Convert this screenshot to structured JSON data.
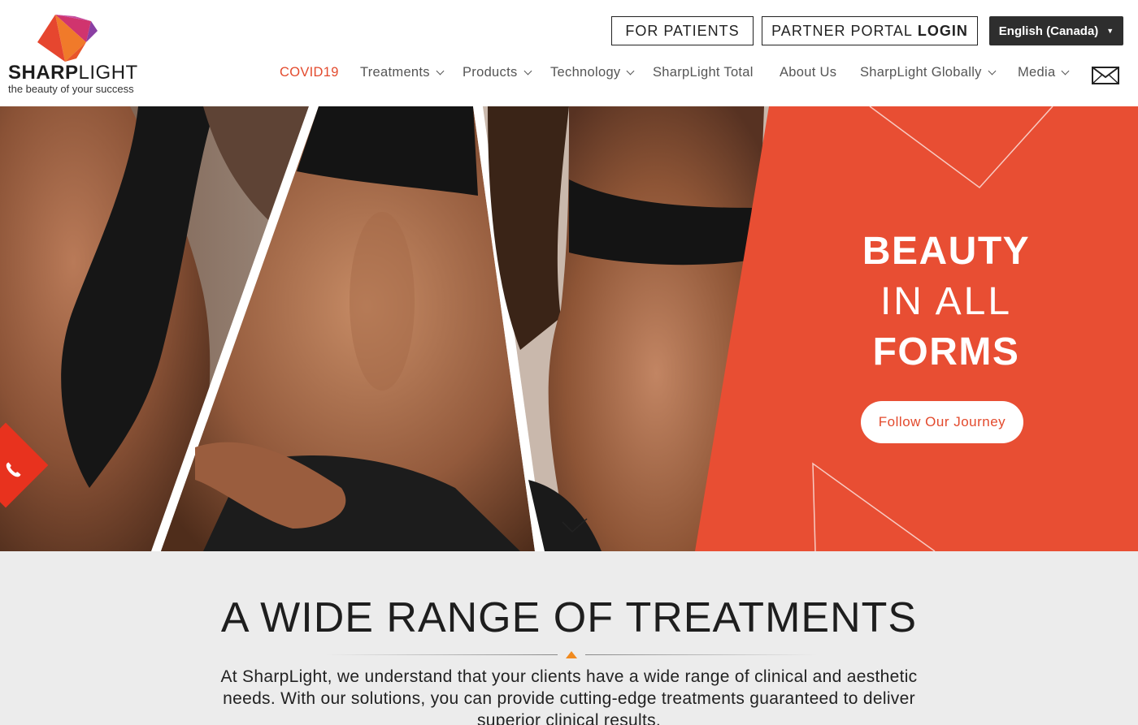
{
  "brand": {
    "name_bold": "SHARP",
    "name_light": "LIGHT",
    "tagline": "the beauty of your success",
    "colors": {
      "accent": "#e34a2d",
      "logo_pink": "#d0346e",
      "logo_orange": "#f07a2a",
      "logo_purple": "#7b3fa0"
    }
  },
  "header": {
    "patients_label": "FOR PATIENTS",
    "portal_label_light": "PARTNER PORTAL",
    "portal_label_bold": "LOGIN",
    "language_selected": "English (Canada)",
    "language_caret": "▼"
  },
  "nav": {
    "items": [
      {
        "label": "COVID19",
        "dropdown": false,
        "active": true
      },
      {
        "label": "Treatments",
        "dropdown": true
      },
      {
        "label": "Products",
        "dropdown": true
      },
      {
        "label": "Technology",
        "dropdown": true
      },
      {
        "label": "SharpLight Total",
        "dropdown": false
      },
      {
        "label": "About Us",
        "dropdown": false
      },
      {
        "label": "SharpLight Globally",
        "dropdown": true
      },
      {
        "label": "Media",
        "dropdown": true
      }
    ],
    "mail_icon": "envelope-icon"
  },
  "hero": {
    "title_line1": "BEAUTY",
    "title_line2": "IN ALL",
    "title_line3": "FORMS",
    "cta_label": "Follow Our Journey",
    "panel_color": "#e84e33",
    "phone_icon": "phone-icon"
  },
  "intro": {
    "title": "A WIDE RANGE OF TREATMENTS",
    "body": "At SharpLight, we understand that your clients have a wide range of clinical and aesthetic needs. With our solutions, you can provide cutting-edge treatments guaranteed to deliver superior clinical results."
  }
}
